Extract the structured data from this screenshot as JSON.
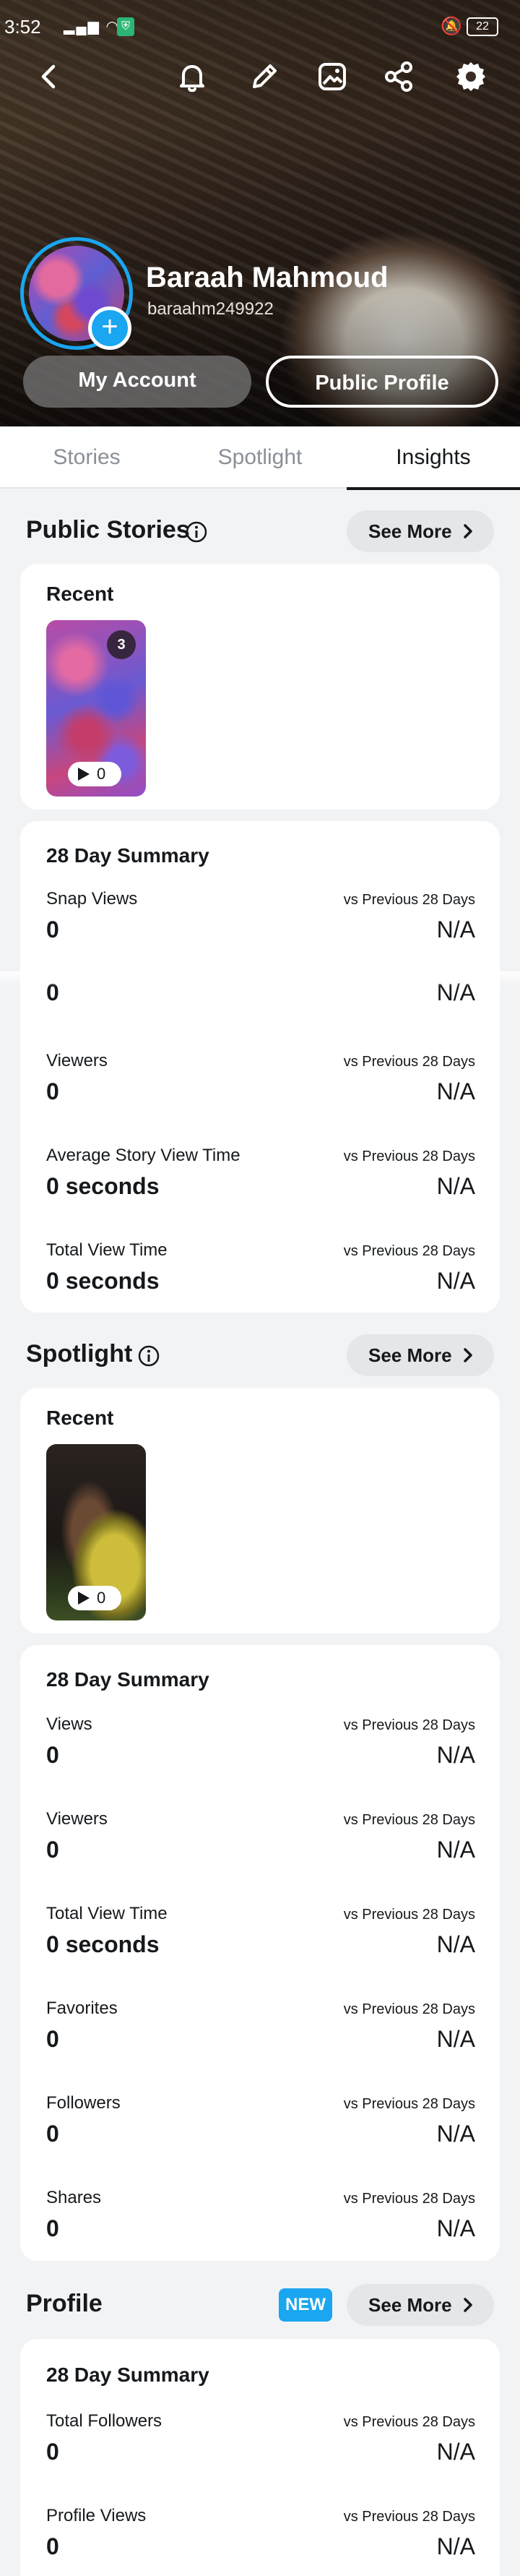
{
  "status_bar": {
    "time": "3:52",
    "signal": "il",
    "battery": "22"
  },
  "profile": {
    "name": "Baraah Mahmoud",
    "username": "baraahm249922",
    "my_account_label": "My Account",
    "public_profile_label": "Public Profile"
  },
  "toolbar_icons": [
    "back-arrow-icon",
    "bell-icon",
    "pencil-icon",
    "gallery-icon",
    "share-icon",
    "gear-icon"
  ],
  "tabs": [
    {
      "label": "Stories"
    },
    {
      "label": "Spotlight"
    },
    {
      "label": "Insights"
    }
  ],
  "active_tab": "Insights",
  "public_stories": {
    "title": "Public Stories",
    "see_more": "See More",
    "recent_label": "Recent",
    "recent_count": "3",
    "recent_views": "0",
    "summary_title": "28 Day Summary",
    "metrics": [
      {
        "label": "Snap Views",
        "value": "0",
        "compare": "vs Previous 28 Days",
        "change": "N/A"
      },
      {
        "label": "",
        "value": "0",
        "compare": "",
        "change": "N/A"
      },
      {
        "label": "Viewers",
        "value": "0",
        "compare": "vs Previous 28 Days",
        "change": "N/A"
      },
      {
        "label": "Average Story View Time",
        "value": "0 seconds",
        "compare": "vs Previous 28 Days",
        "change": "N/A"
      },
      {
        "label": "Total View Time",
        "value": "0 seconds",
        "compare": "vs Previous 28 Days",
        "change": "N/A"
      }
    ]
  },
  "spotlight": {
    "title": "Spotlight",
    "see_more": "See More",
    "recent_label": "Recent",
    "recent_views": "0",
    "summary_title": "28 Day Summary",
    "metrics": [
      {
        "label": "Views",
        "value": "0",
        "compare": "vs Previous 28 Days",
        "change": "N/A"
      },
      {
        "label": "Viewers",
        "value": "0",
        "compare": "vs Previous 28 Days",
        "change": "N/A"
      },
      {
        "label": "Total View Time",
        "value": "0 seconds",
        "compare": "vs Previous 28 Days",
        "change": "N/A"
      },
      {
        "label": "Favorites",
        "value": "0",
        "compare": "vs Previous 28 Days",
        "change": "N/A"
      },
      {
        "label": "Followers",
        "value": "0",
        "compare": "vs Previous 28 Days",
        "change": "N/A"
      },
      {
        "label": "Shares",
        "value": "0",
        "compare": "vs Previous 28 Days",
        "change": "N/A"
      }
    ]
  },
  "profile_section": {
    "title": "Profile",
    "badge": "NEW",
    "see_more": "See More",
    "summary_title": "28 Day Summary",
    "metrics": [
      {
        "label": "Total Followers",
        "value": "0",
        "compare": "vs Previous 28 Days",
        "change": "N/A"
      },
      {
        "label": "Profile Views",
        "value": "0",
        "compare": "vs Previous 28 Days",
        "change": "N/A"
      }
    ]
  },
  "colors": {
    "accent": "#1aa6f0",
    "card": "#ffffff",
    "background": "#f2f3f5",
    "pill": "#e4e6e9"
  }
}
